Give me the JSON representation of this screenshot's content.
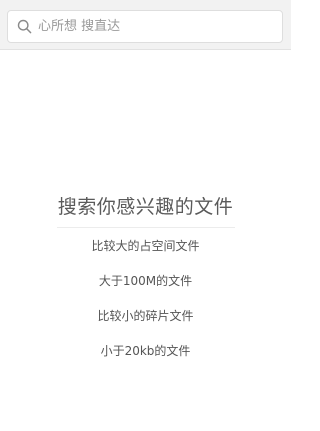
{
  "search": {
    "placeholder": "心所想 搜直达",
    "value": ""
  },
  "main": {
    "title": "搜索你感兴趣的文件",
    "suggestions": [
      {
        "label": "比较大的占空间文件"
      },
      {
        "label": "大于100M的文件"
      },
      {
        "label": "比较小的碎片文件"
      },
      {
        "label": "小于20kb的文件"
      }
    ]
  },
  "colors": {
    "top_bar_bg": "#f2f2f2",
    "title_text": "#5a5a5a",
    "suggestion_text": "#555555",
    "placeholder_text": "#9a9a9a"
  },
  "icons": {
    "search": "search-icon"
  }
}
